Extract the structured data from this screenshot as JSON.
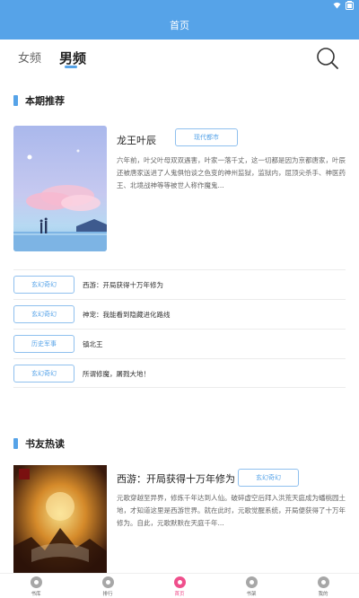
{
  "app_bar": {
    "title": "首页"
  },
  "tabs": [
    {
      "label": "女频",
      "selected": false
    },
    {
      "label": "男频",
      "selected": true
    }
  ],
  "colors": {
    "accent": "#56a3e8",
    "nav_active": "#ef4f8c"
  },
  "sections": {
    "recommend_title": "本期推荐",
    "hot_title": "书友热读"
  },
  "featured": {
    "title": "龙王叶辰",
    "genre": "现代都市",
    "description": "六年前，叶父叶母双双遇害，叶家一落千丈，这一切都是因为京都唐家，叶辰还被唐家送进了人鬼俱怕谈之色变的神州监狱，监狱内，屈顶尖杀手、神医药王、北境战神等等被世人称作魔鬼..."
  },
  "list": [
    {
      "genre": "玄幻奇幻",
      "title": "西游：开局获得十万年修为"
    },
    {
      "genre": "玄幻奇幻",
      "title": "神宠：我能看到隐藏进化路线"
    },
    {
      "genre": "历史军事",
      "title": "镇北王"
    },
    {
      "genre": "玄幻奇幻",
      "title": "所谓修魔，屠戮大地！"
    }
  ],
  "hot_book": {
    "title": "西游：开局获得十万年修为",
    "genre": "玄幻奇幻",
    "description": "元歌穿越至异界，修炼千年达到人仙。破碎虚空后拜入洪荒天庭成为蟠桃园土地，才知道这里是西游世界。就在此时，元歌觉醒系统，开局便获得了十万年修为。自此，元歌默默在天庭千年..."
  },
  "bottom_nav": [
    {
      "label": "书库",
      "icon": "library-icon",
      "active": false
    },
    {
      "label": "排行",
      "icon": "crown-icon",
      "active": false
    },
    {
      "label": "首页",
      "icon": "home-icon",
      "active": true
    },
    {
      "label": "书架",
      "icon": "bookshelf-icon",
      "active": false
    },
    {
      "label": "我的",
      "icon": "profile-icon",
      "active": false
    }
  ]
}
